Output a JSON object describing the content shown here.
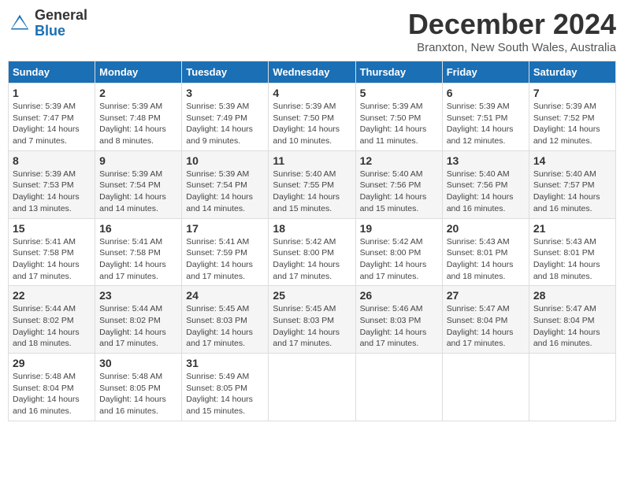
{
  "logo": {
    "general": "General",
    "blue": "Blue"
  },
  "title": "December 2024",
  "subtitle": "Branxton, New South Wales, Australia",
  "days_of_week": [
    "Sunday",
    "Monday",
    "Tuesday",
    "Wednesday",
    "Thursday",
    "Friday",
    "Saturday"
  ],
  "weeks": [
    [
      {
        "day": "1",
        "sunrise": "Sunrise: 5:39 AM",
        "sunset": "Sunset: 7:47 PM",
        "daylight": "Daylight: 14 hours and 7 minutes."
      },
      {
        "day": "2",
        "sunrise": "Sunrise: 5:39 AM",
        "sunset": "Sunset: 7:48 PM",
        "daylight": "Daylight: 14 hours and 8 minutes."
      },
      {
        "day": "3",
        "sunrise": "Sunrise: 5:39 AM",
        "sunset": "Sunset: 7:49 PM",
        "daylight": "Daylight: 14 hours and 9 minutes."
      },
      {
        "day": "4",
        "sunrise": "Sunrise: 5:39 AM",
        "sunset": "Sunset: 7:50 PM",
        "daylight": "Daylight: 14 hours and 10 minutes."
      },
      {
        "day": "5",
        "sunrise": "Sunrise: 5:39 AM",
        "sunset": "Sunset: 7:50 PM",
        "daylight": "Daylight: 14 hours and 11 minutes."
      },
      {
        "day": "6",
        "sunrise": "Sunrise: 5:39 AM",
        "sunset": "Sunset: 7:51 PM",
        "daylight": "Daylight: 14 hours and 12 minutes."
      },
      {
        "day": "7",
        "sunrise": "Sunrise: 5:39 AM",
        "sunset": "Sunset: 7:52 PM",
        "daylight": "Daylight: 14 hours and 12 minutes."
      }
    ],
    [
      {
        "day": "8",
        "sunrise": "Sunrise: 5:39 AM",
        "sunset": "Sunset: 7:53 PM",
        "daylight": "Daylight: 14 hours and 13 minutes."
      },
      {
        "day": "9",
        "sunrise": "Sunrise: 5:39 AM",
        "sunset": "Sunset: 7:54 PM",
        "daylight": "Daylight: 14 hours and 14 minutes."
      },
      {
        "day": "10",
        "sunrise": "Sunrise: 5:39 AM",
        "sunset": "Sunset: 7:54 PM",
        "daylight": "Daylight: 14 hours and 14 minutes."
      },
      {
        "day": "11",
        "sunrise": "Sunrise: 5:40 AM",
        "sunset": "Sunset: 7:55 PM",
        "daylight": "Daylight: 14 hours and 15 minutes."
      },
      {
        "day": "12",
        "sunrise": "Sunrise: 5:40 AM",
        "sunset": "Sunset: 7:56 PM",
        "daylight": "Daylight: 14 hours and 15 minutes."
      },
      {
        "day": "13",
        "sunrise": "Sunrise: 5:40 AM",
        "sunset": "Sunset: 7:56 PM",
        "daylight": "Daylight: 14 hours and 16 minutes."
      },
      {
        "day": "14",
        "sunrise": "Sunrise: 5:40 AM",
        "sunset": "Sunset: 7:57 PM",
        "daylight": "Daylight: 14 hours and 16 minutes."
      }
    ],
    [
      {
        "day": "15",
        "sunrise": "Sunrise: 5:41 AM",
        "sunset": "Sunset: 7:58 PM",
        "daylight": "Daylight: 14 hours and 17 minutes."
      },
      {
        "day": "16",
        "sunrise": "Sunrise: 5:41 AM",
        "sunset": "Sunset: 7:58 PM",
        "daylight": "Daylight: 14 hours and 17 minutes."
      },
      {
        "day": "17",
        "sunrise": "Sunrise: 5:41 AM",
        "sunset": "Sunset: 7:59 PM",
        "daylight": "Daylight: 14 hours and 17 minutes."
      },
      {
        "day": "18",
        "sunrise": "Sunrise: 5:42 AM",
        "sunset": "Sunset: 8:00 PM",
        "daylight": "Daylight: 14 hours and 17 minutes."
      },
      {
        "day": "19",
        "sunrise": "Sunrise: 5:42 AM",
        "sunset": "Sunset: 8:00 PM",
        "daylight": "Daylight: 14 hours and 17 minutes."
      },
      {
        "day": "20",
        "sunrise": "Sunrise: 5:43 AM",
        "sunset": "Sunset: 8:01 PM",
        "daylight": "Daylight: 14 hours and 18 minutes."
      },
      {
        "day": "21",
        "sunrise": "Sunrise: 5:43 AM",
        "sunset": "Sunset: 8:01 PM",
        "daylight": "Daylight: 14 hours and 18 minutes."
      }
    ],
    [
      {
        "day": "22",
        "sunrise": "Sunrise: 5:44 AM",
        "sunset": "Sunset: 8:02 PM",
        "daylight": "Daylight: 14 hours and 18 minutes."
      },
      {
        "day": "23",
        "sunrise": "Sunrise: 5:44 AM",
        "sunset": "Sunset: 8:02 PM",
        "daylight": "Daylight: 14 hours and 17 minutes."
      },
      {
        "day": "24",
        "sunrise": "Sunrise: 5:45 AM",
        "sunset": "Sunset: 8:03 PM",
        "daylight": "Daylight: 14 hours and 17 minutes."
      },
      {
        "day": "25",
        "sunrise": "Sunrise: 5:45 AM",
        "sunset": "Sunset: 8:03 PM",
        "daylight": "Daylight: 14 hours and 17 minutes."
      },
      {
        "day": "26",
        "sunrise": "Sunrise: 5:46 AM",
        "sunset": "Sunset: 8:03 PM",
        "daylight": "Daylight: 14 hours and 17 minutes."
      },
      {
        "day": "27",
        "sunrise": "Sunrise: 5:47 AM",
        "sunset": "Sunset: 8:04 PM",
        "daylight": "Daylight: 14 hours and 17 minutes."
      },
      {
        "day": "28",
        "sunrise": "Sunrise: 5:47 AM",
        "sunset": "Sunset: 8:04 PM",
        "daylight": "Daylight: 14 hours and 16 minutes."
      }
    ],
    [
      {
        "day": "29",
        "sunrise": "Sunrise: 5:48 AM",
        "sunset": "Sunset: 8:04 PM",
        "daylight": "Daylight: 14 hours and 16 minutes."
      },
      {
        "day": "30",
        "sunrise": "Sunrise: 5:48 AM",
        "sunset": "Sunset: 8:05 PM",
        "daylight": "Daylight: 14 hours and 16 minutes."
      },
      {
        "day": "31",
        "sunrise": "Sunrise: 5:49 AM",
        "sunset": "Sunset: 8:05 PM",
        "daylight": "Daylight: 14 hours and 15 minutes."
      },
      null,
      null,
      null,
      null
    ]
  ]
}
